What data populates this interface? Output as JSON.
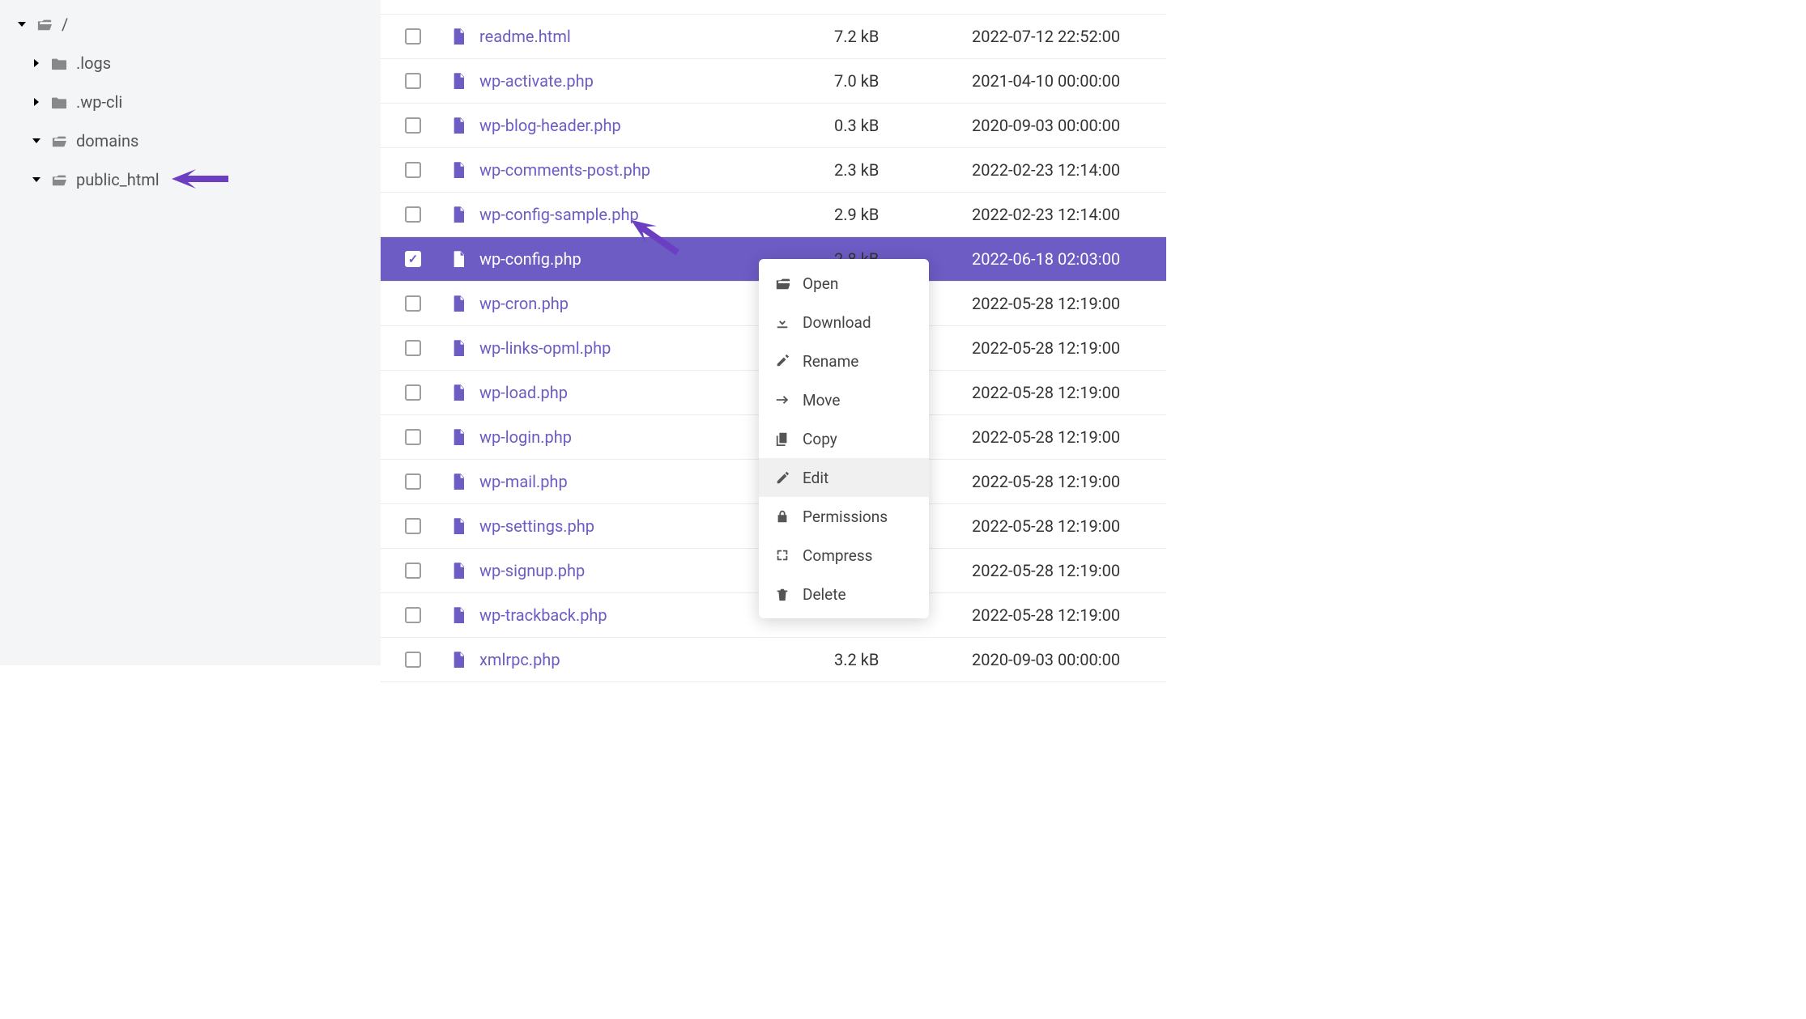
{
  "sidebar": {
    "root": "/",
    "items": [
      {
        "expand": "right",
        "label": ".logs"
      },
      {
        "expand": "right",
        "label": ".wp-cli"
      },
      {
        "expand": "down",
        "label": "domains"
      },
      {
        "expand": "down",
        "label": "public_html",
        "link": true
      }
    ]
  },
  "files": [
    {
      "name": "readme.html",
      "size": "7.2 kB",
      "date": "2022-07-12 22:52:00",
      "selected": false
    },
    {
      "name": "wp-activate.php",
      "size": "7.0 kB",
      "date": "2021-04-10 00:00:00",
      "selected": false
    },
    {
      "name": "wp-blog-header.php",
      "size": "0.3 kB",
      "date": "2020-09-03 00:00:00",
      "selected": false
    },
    {
      "name": "wp-comments-post.php",
      "size": "2.3 kB",
      "date": "2022-02-23 12:14:00",
      "selected": false
    },
    {
      "name": "wp-config-sample.php",
      "size": "2.9 kB",
      "date": "2022-02-23 12:14:00",
      "selected": false
    },
    {
      "name": "wp-config.php",
      "size": "2.8 kB",
      "date": "2022-06-18 02:03:00",
      "selected": true
    },
    {
      "name": "wp-cron.php",
      "size": "",
      "date": "2022-05-28 12:19:00",
      "selected": false
    },
    {
      "name": "wp-links-opml.php",
      "size": "",
      "date": "2022-05-28 12:19:00",
      "selected": false
    },
    {
      "name": "wp-load.php",
      "size": "",
      "date": "2022-05-28 12:19:00",
      "selected": false
    },
    {
      "name": "wp-login.php",
      "size": "",
      "date": "2022-05-28 12:19:00",
      "selected": false
    },
    {
      "name": "wp-mail.php",
      "size": "",
      "date": "2022-05-28 12:19:00",
      "selected": false
    },
    {
      "name": "wp-settings.php",
      "size": "",
      "date": "2022-05-28 12:19:00",
      "selected": false
    },
    {
      "name": "wp-signup.php",
      "size": "",
      "date": "2022-05-28 12:19:00",
      "selected": false
    },
    {
      "name": "wp-trackback.php",
      "size": "",
      "date": "2022-05-28 12:19:00",
      "selected": false
    },
    {
      "name": "xmlrpc.php",
      "size": "3.2 kB",
      "date": "2020-09-03 00:00:00",
      "selected": false
    }
  ],
  "menu": {
    "items": [
      {
        "icon": "folder-open",
        "label": "Open"
      },
      {
        "icon": "download",
        "label": "Download"
      },
      {
        "icon": "rename",
        "label": "Rename"
      },
      {
        "icon": "move",
        "label": "Move"
      },
      {
        "icon": "copy",
        "label": "Copy"
      },
      {
        "icon": "edit",
        "label": "Edit",
        "hover": true
      },
      {
        "icon": "lock",
        "label": "Permissions"
      },
      {
        "icon": "compress",
        "label": "Compress"
      },
      {
        "icon": "trash",
        "label": "Delete"
      }
    ]
  }
}
